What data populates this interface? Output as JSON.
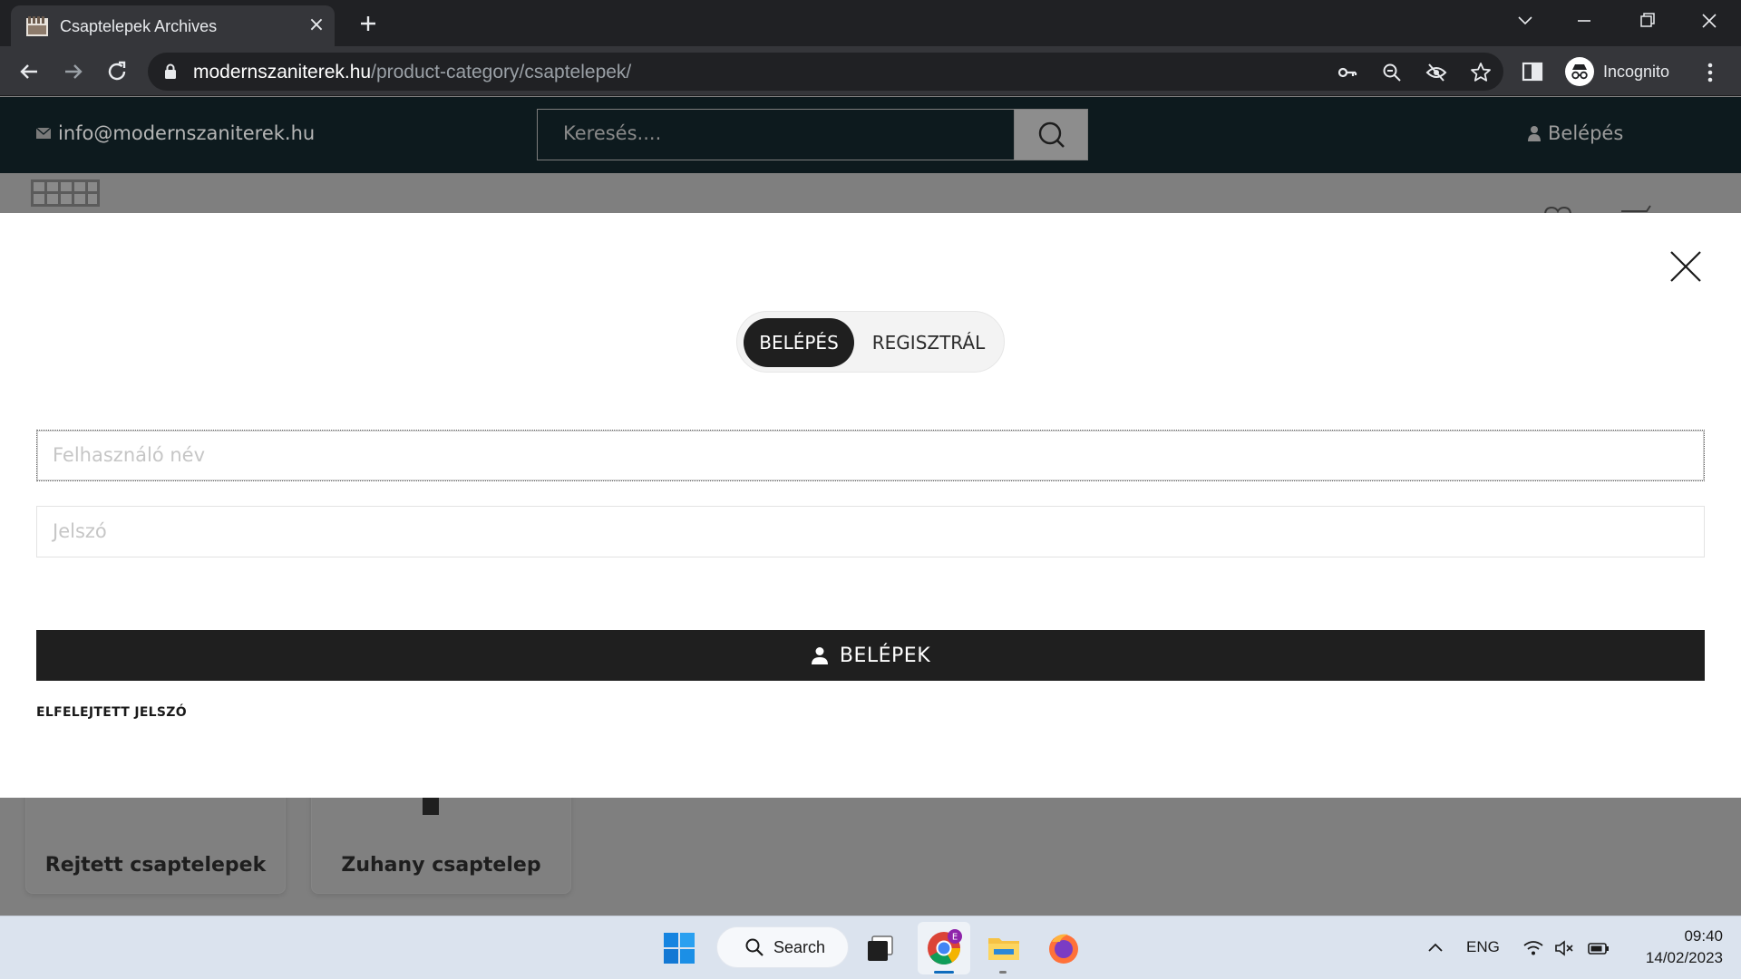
{
  "browser": {
    "tab_title": "Csaptelepek Archives",
    "tab_close_glyph": "×",
    "url_host": "modernszaniterek.hu",
    "url_path": "/product-category/csaptelepek/",
    "profile_label": "Incognito"
  },
  "site": {
    "email": "info@modernszaniterek.hu",
    "search_placeholder": "Keresés....",
    "login_link": "Belépés",
    "categories": [
      {
        "label": "Rejtett csaptelepek"
      },
      {
        "label": "Zuhany csaptelep"
      }
    ]
  },
  "modal": {
    "tab_login": "BELÉPÉS",
    "tab_register": "REGISZTRÁL",
    "username_placeholder": "Felhasználó név",
    "password_placeholder": "Jelszó",
    "submit_label": "BELÉPEK",
    "forgot_label": "ELFELEJTETT JELSZÓ"
  },
  "taskbar": {
    "search_label": "Search",
    "language": "ENG",
    "time": "09:40",
    "date": "14/02/2023",
    "chrome_badge": "E"
  },
  "colors": {
    "browser_frame": "#202124",
    "site_topbar": "#0d1a1e",
    "modal_dark": "#1f1f1f",
    "overlay": "#7f7f7f"
  }
}
